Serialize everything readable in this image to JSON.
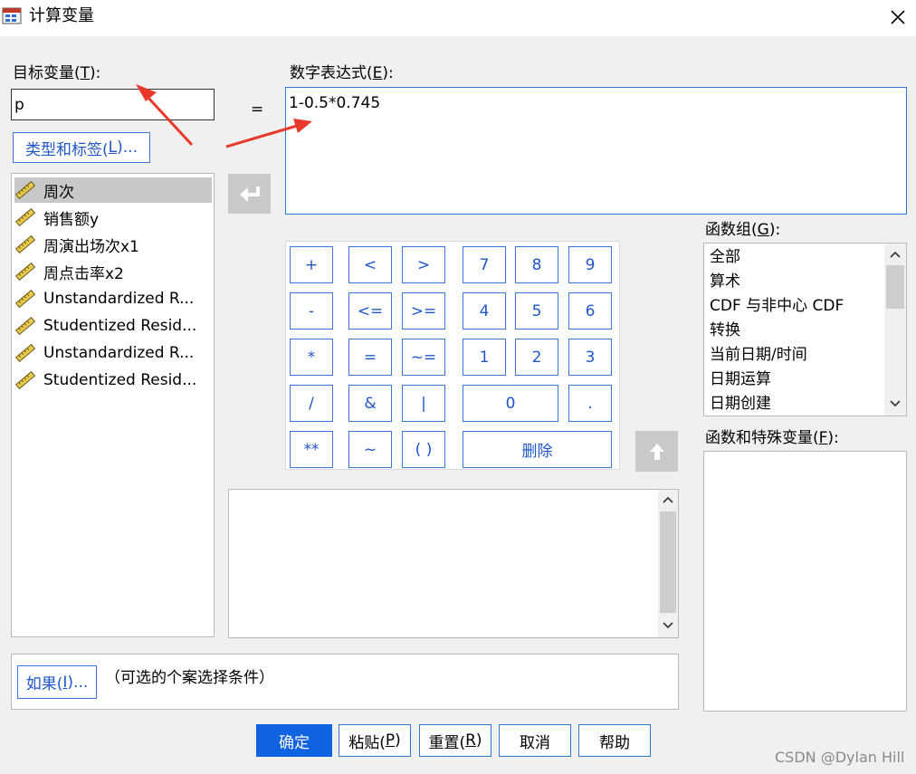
{
  "window": {
    "title": "计算变量"
  },
  "target": {
    "label": "目标变量(",
    "label_key": "T",
    "label_suffix": "):",
    "value": "p",
    "type_label_button": "类型和标签(",
    "type_label_key": "L",
    "type_label_suffix": ")..."
  },
  "equals": "=",
  "expression": {
    "label": "数字表达式(",
    "label_key": "E",
    "label_suffix": "):",
    "value": "1-0.5*0.745"
  },
  "variables": [
    {
      "name": "周次"
    },
    {
      "name": "销售额y"
    },
    {
      "name": "周演出场次x1"
    },
    {
      "name": "周点击率x2"
    },
    {
      "name": "Unstandardized R..."
    },
    {
      "name": "Studentized Resid..."
    },
    {
      "name": "Unstandardized R..."
    },
    {
      "name": "Studentized Resid..."
    }
  ],
  "keypad": {
    "plus": "+",
    "lt": "<",
    "gt": ">",
    "k7": "7",
    "k8": "8",
    "k9": "9",
    "minus": "-",
    "le": "<=",
    "ge": ">=",
    "k4": "4",
    "k5": "5",
    "k6": "6",
    "mult": "*",
    "eq": "=",
    "ne": "~=",
    "k1": "1",
    "k2": "2",
    "k3": "3",
    "div": "/",
    "and": "&",
    "or": "|",
    "k0": "0",
    "dot": ".",
    "pow": "**",
    "not": "~",
    "paren": "( )",
    "delete": "删除"
  },
  "function_group": {
    "label": "函数组(",
    "label_key": "G",
    "label_suffix": "):",
    "items": [
      "全部",
      "算术",
      "CDF 与非中心 CDF",
      "转换",
      "当前日期/时间",
      "日期运算",
      "日期创建"
    ]
  },
  "functions": {
    "label": "函数和特殊变量(",
    "label_key": "F",
    "label_suffix": "):"
  },
  "condition": {
    "button": "如果(",
    "button_key": "I",
    "button_suffix": ")...",
    "text": "（可选的个案选择条件）"
  },
  "buttons": {
    "ok": "确定",
    "paste": "粘贴(",
    "paste_key": "P",
    "paste_suffix": ")",
    "reset": "重置(",
    "reset_key": "R",
    "reset_suffix": ")",
    "cancel": "取消",
    "help": "帮助"
  },
  "watermark": "CSDN @Dylan Hill",
  "colors": {
    "accent": "#2d7ad6",
    "ok_bg": "#0f62e0",
    "annotation": "#e8392a"
  }
}
